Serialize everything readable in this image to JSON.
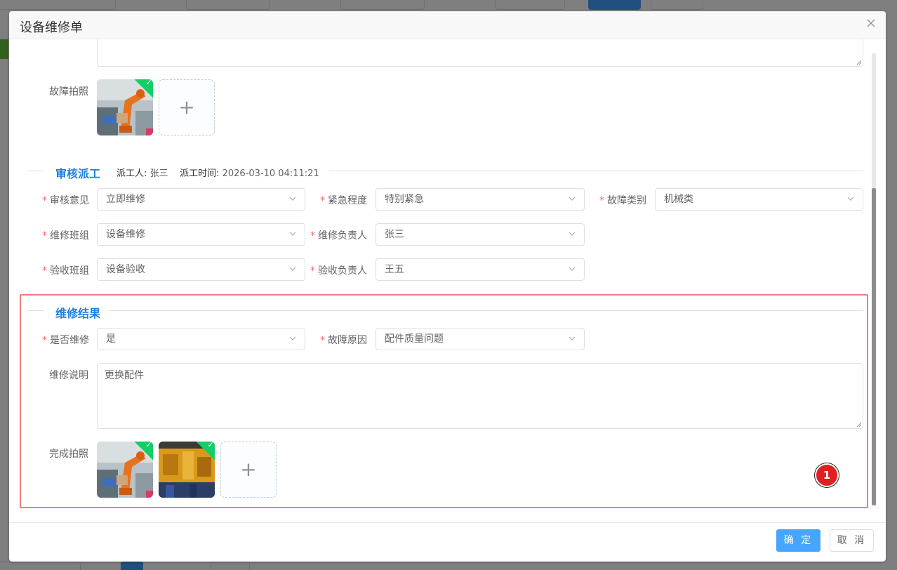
{
  "dialog": {
    "title": "设备维修单",
    "close_icon": "close-icon"
  },
  "fault_photo": {
    "label": "故障拍照",
    "plus": "+"
  },
  "audit": {
    "title": "审核派工",
    "dispatcher_label": "派工人:",
    "dispatcher": "张三",
    "dispatch_time_label": "派工时间:",
    "dispatch_time": "2026-03-10 04:11:21",
    "fields": {
      "opinion": {
        "label": "审核意见",
        "value": "立即维修"
      },
      "urgency": {
        "label": "紧急程度",
        "value": "特别紧急"
      },
      "fault_type": {
        "label": "故障类别",
        "value": "机械类"
      },
      "repair_team": {
        "label": "维修班组",
        "value": "设备维修"
      },
      "repair_owner": {
        "label": "维修负责人",
        "value": "张三"
      },
      "accept_team": {
        "label": "验收班组",
        "value": "设备验收"
      },
      "accept_owner": {
        "label": "验收负责人",
        "value": "王五"
      }
    }
  },
  "result": {
    "title": "维修结果",
    "fields": {
      "is_repaired": {
        "label": "是否维修",
        "value": "是"
      },
      "fault_cause": {
        "label": "故障原因",
        "value": "配件质量问题"
      },
      "description": {
        "label": "维修说明",
        "value": "更换配件"
      },
      "photos": {
        "label": "完成拍照",
        "plus": "+"
      }
    }
  },
  "badge": "1",
  "footer": {
    "confirm": "确 定",
    "cancel": "取 消"
  },
  "colors": {
    "primary": "#46a6ff",
    "section_title": "#1f7fe0",
    "highlight": "#f47a7a",
    "required": "#f56c6c",
    "success": "#13ce66"
  }
}
